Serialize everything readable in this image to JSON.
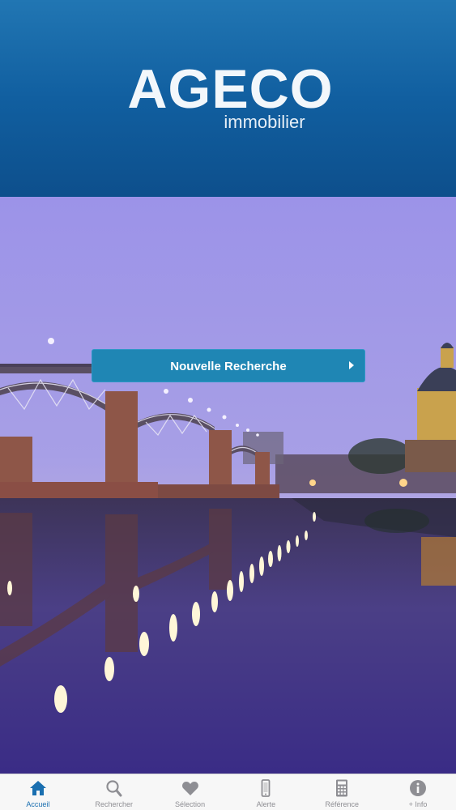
{
  "header": {
    "brand": "AGECO",
    "tagline": "immobilier"
  },
  "hero": {
    "button_label": "Nouvelle Recherche"
  },
  "tabbar": {
    "active": "Accueil",
    "items": [
      {
        "label": "Accueil",
        "icon": "home-icon"
      },
      {
        "label": "Rechercher",
        "icon": "search-icon"
      },
      {
        "label": "Sélection",
        "icon": "heart-icon"
      },
      {
        "label": "Alerte",
        "icon": "phone-icon"
      },
      {
        "label": "Référence",
        "icon": "calculator-icon"
      },
      {
        "label": "+ Info",
        "icon": "info-icon"
      }
    ]
  },
  "colors": {
    "header": "#115fa0",
    "button": "#1f86b4",
    "tab_active": "#1a6fb0",
    "tab_inactive": "#8e8e93"
  }
}
